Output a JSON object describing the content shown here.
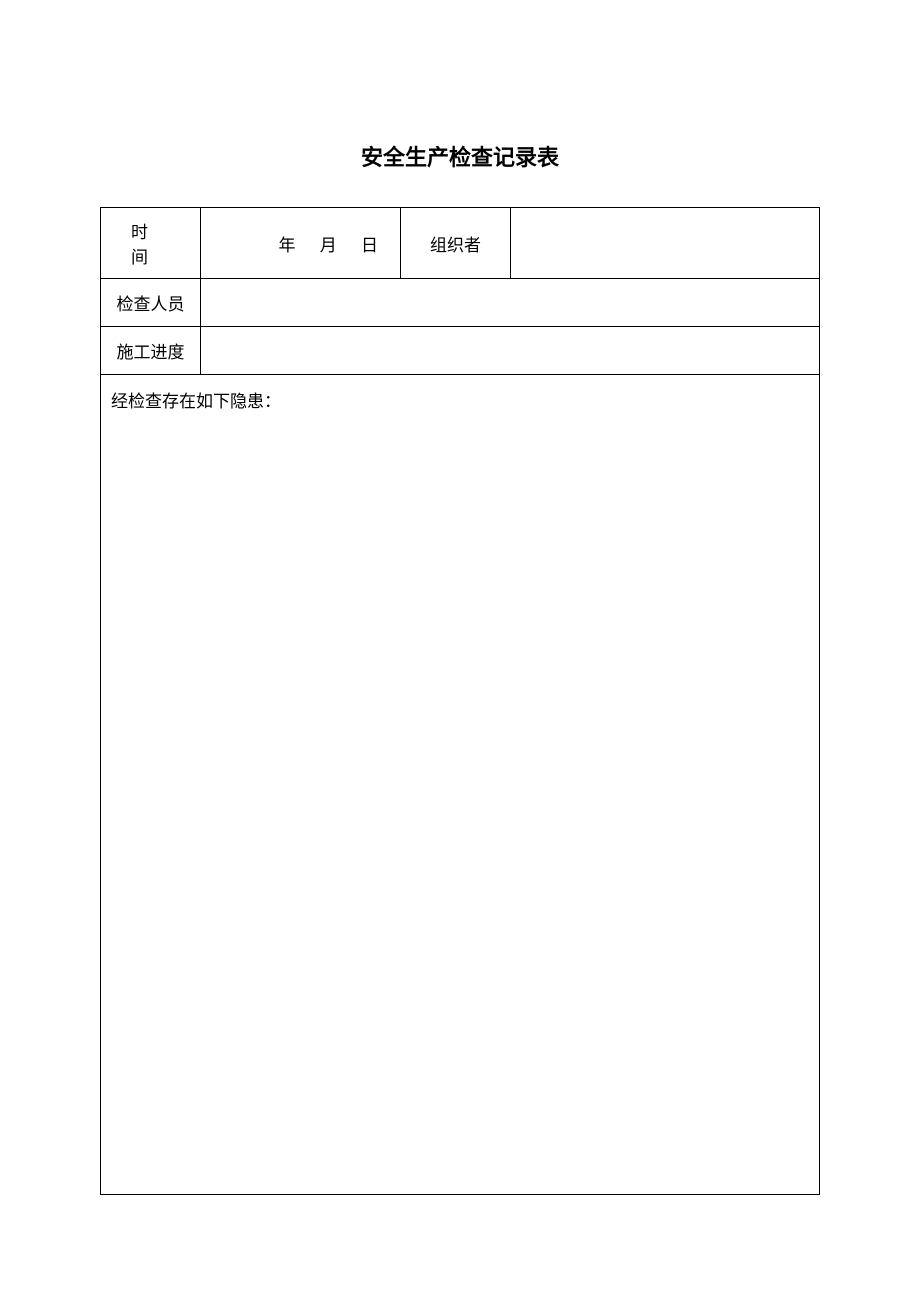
{
  "title": "安全生产检查记录表",
  "row1": {
    "time_label": "时间",
    "date_value": "年 月 日",
    "organizer_label": "组织者",
    "organizer_value": ""
  },
  "row2": {
    "inspectors_label": "检查人员",
    "inspectors_value": ""
  },
  "row3": {
    "progress_label": "施工进度",
    "progress_value": ""
  },
  "row4": {
    "hazards_label": "经检查存在如下隐患："
  }
}
